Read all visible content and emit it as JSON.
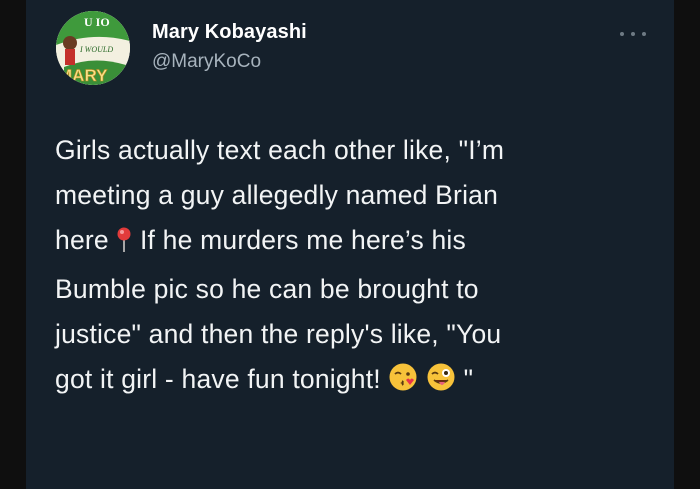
{
  "author": {
    "display_name": "Mary Kobayashi",
    "handle": "@MaryKoCo",
    "avatar_text": "MARY",
    "avatar_top_text": "U IO",
    "avatar_mid_text": "I WOULD"
  },
  "tweet": {
    "lines": [
      "Girls actually text each other like, \"I’m",
      "meeting a guy allegedly named Brian",
      "here",
      " If he murders me here’s his",
      "Bumble pic so he can be brought to",
      "justice\" and then the reply's like, \"You",
      "got it girl - have fun tonight! ",
      " \""
    ]
  },
  "icons": {
    "pin": "round-pushpin-icon",
    "kiss_face": "face-blowing-kiss-icon",
    "wink_face": "winking-face-with-tongue-icon",
    "more": "more-options-icon"
  },
  "colors": {
    "background": "#15202b",
    "text": "#f2f4f5",
    "muted": "#a7b3bd",
    "outer": "#0f0f0f"
  }
}
